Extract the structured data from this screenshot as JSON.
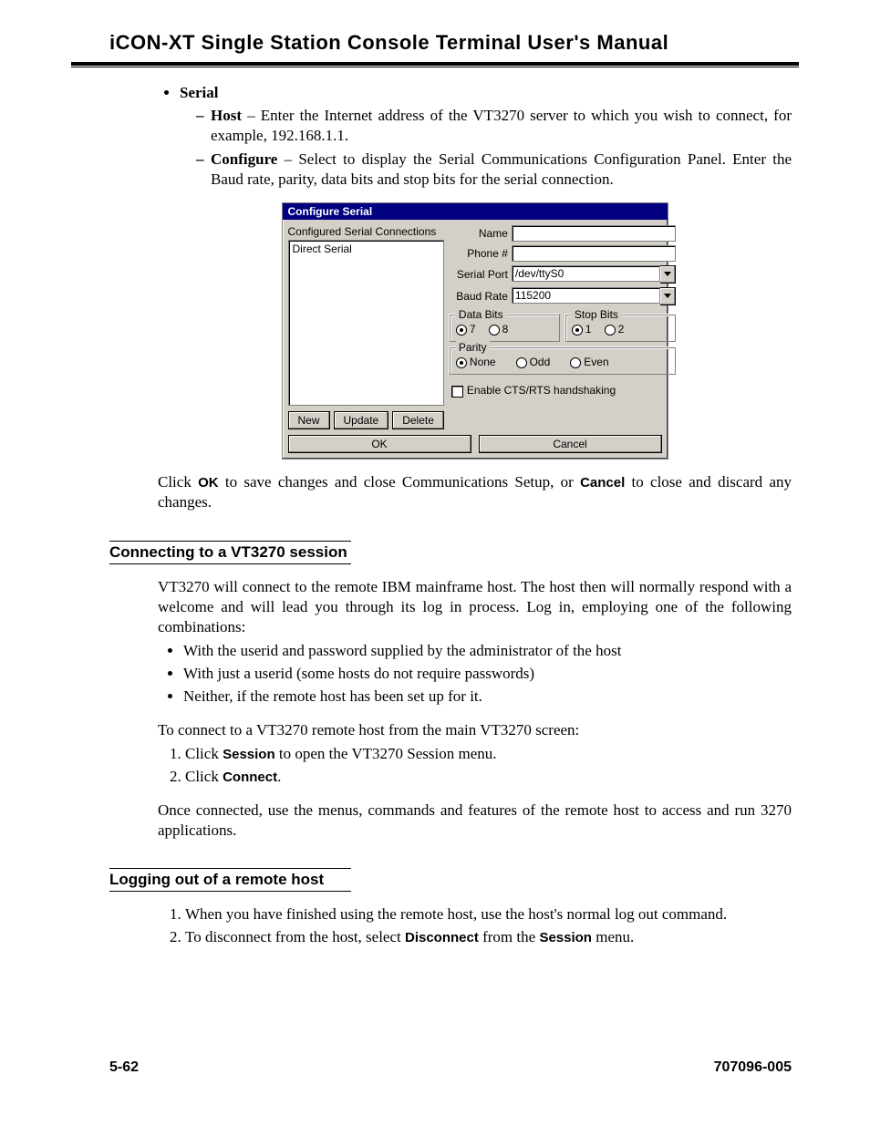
{
  "header": "iCON-XT  Single  Station  Console  Terminal  User's  Manual",
  "list": {
    "serial_label": "Serial",
    "host_label": "Host",
    "host_text": " – Enter the Internet address of the VT3270 server to which you wish to connect, for example, 192.168.1.1.",
    "configure_label": "Configure",
    "configure_text": " – Select to display the Serial Communications Configuration Panel. Enter the Baud rate, parity, data bits and stop bits for the serial connection."
  },
  "dialog": {
    "title": "Configure Serial",
    "left": {
      "list_label": "Configured Serial Connections",
      "item": "Direct Serial",
      "btn_new": "New",
      "btn_update": "Update",
      "btn_delete": "Delete"
    },
    "fields": {
      "name_label": "Name",
      "name_value": "",
      "phone_label": "Phone #",
      "phone_value": "",
      "serial_label": "Serial Port",
      "serial_value": "/dev/ttyS0",
      "baud_label": "Baud Rate",
      "baud_value": "115200"
    },
    "data_bits": {
      "legend": "Data Bits",
      "opt1": "7",
      "opt2": "8",
      "selected": "7"
    },
    "stop_bits": {
      "legend": "Stop Bits",
      "opt1": "1",
      "opt2": "2",
      "selected": "1"
    },
    "parity": {
      "legend": "Parity",
      "opt1": "None",
      "opt2": "Odd",
      "opt3": "Even",
      "selected": "None"
    },
    "handshake_label": "Enable CTS/RTS handshaking",
    "ok": "OK",
    "cancel": "Cancel"
  },
  "after_dialog": {
    "pre": "Click ",
    "ok": "OK",
    "mid": " to save changes and close Communications Setup, or ",
    "cancel": "Cancel",
    "post": " to close and discard any changes."
  },
  "sec1": {
    "head": "Connecting to a VT3270 session",
    "p1": "VT3270 will connect to the remote IBM mainframe host. The host then will normally respond with a welcome and will lead you through its log in process. Log in, employing one of the following combinations:",
    "b1": "With the userid and password supplied by the administrator of the host",
    "b2": "With just a userid (some hosts do not require passwords)",
    "b3": "Neither, if the remote host has been set up for it.",
    "p2": "To connect to a VT3270 remote host from the main VT3270 screen:",
    "n1a": "Click ",
    "n1b": "Session",
    "n1c": " to open the VT3270 Session menu.",
    "n2a": "Click ",
    "n2b": "Connect",
    "n2c": ".",
    "p3": "Once connected, use the menus, commands and features of the remote host to access and run 3270 applications."
  },
  "sec2": {
    "head": "Logging out of a remote host",
    "n1": "When you have finished using the remote host, use the host's normal log out command.",
    "n2a": "To disconnect from the host, select ",
    "n2b": "Disconnect",
    "n2c": " from the ",
    "n2d": "Session",
    "n2e": " menu."
  },
  "footer": {
    "left": "5-62",
    "right": "707096-005"
  }
}
